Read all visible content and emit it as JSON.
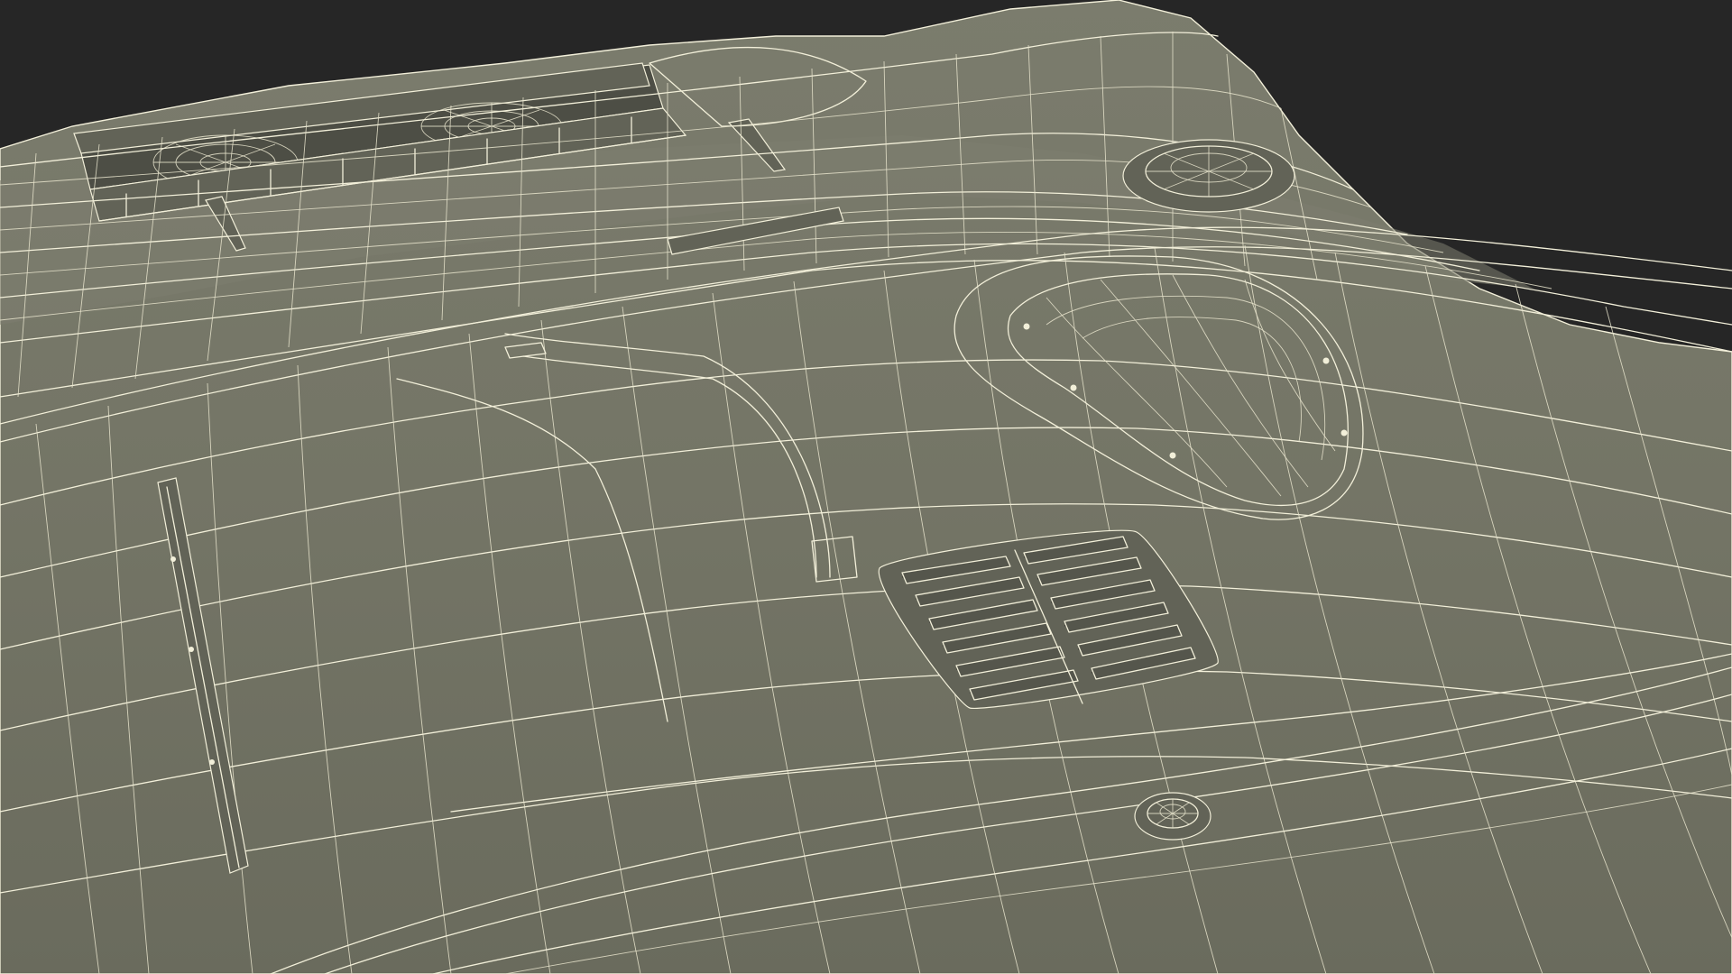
{
  "scene": {
    "subject": "wireframe-car-body-panel",
    "colors": {
      "background": "#262626",
      "surface": "#747566",
      "surface_shadow": "#5d5e52",
      "surface_dark": "#4d4e45",
      "wire": "#f2efd9"
    },
    "features": [
      "hood-scoop",
      "vent-louvers",
      "round-hatch",
      "small-dome",
      "washer-nozzles"
    ]
  }
}
